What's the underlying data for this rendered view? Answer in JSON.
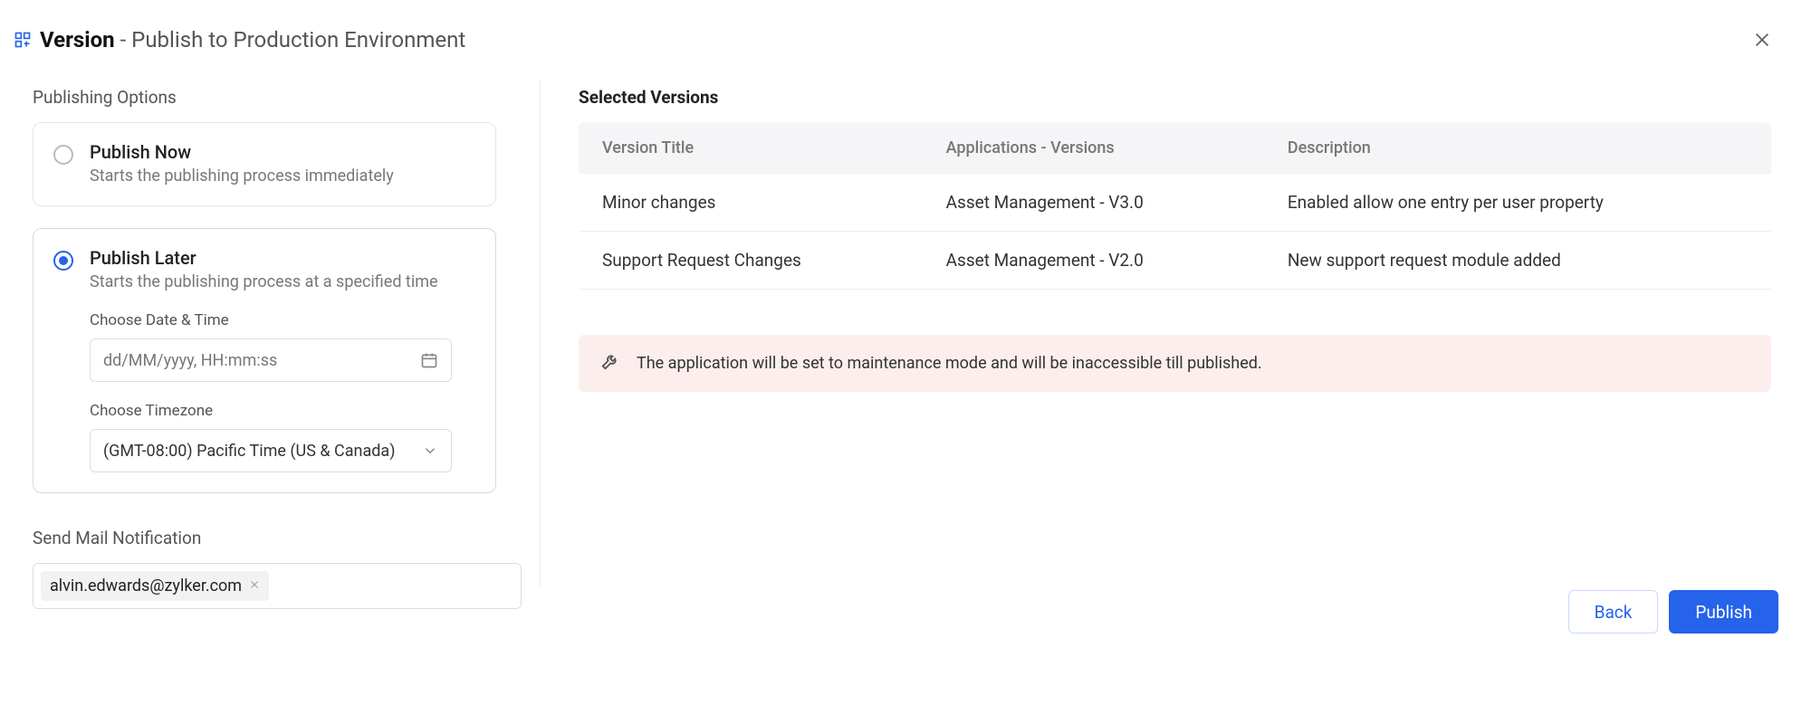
{
  "header": {
    "title_bold": "Version",
    "title_sub": "- Publish to Production Environment"
  },
  "left": {
    "publishing_options_label": "Publishing Options",
    "option_now": {
      "title": "Publish Now",
      "desc": "Starts the publishing process immediately"
    },
    "option_later": {
      "title": "Publish Later",
      "desc": "Starts the publishing process at a specified time",
      "date_label": "Choose Date & Time",
      "date_placeholder": "dd/MM/yyyy, HH:mm:ss",
      "tz_label": "Choose Timezone",
      "tz_value": "(GMT-08:00) Pacific Time (US & Canada)"
    },
    "mail_label": "Send Mail Notification",
    "mail_recipients": [
      "alvin.edwards@zylker.com"
    ]
  },
  "right": {
    "selected_versions_label": "Selected Versions",
    "columns": {
      "c1": "Version Title",
      "c2": "Applications - Versions",
      "c3": "Description"
    },
    "rows": [
      {
        "title": "Minor changes",
        "app": "Asset Management - V3.0",
        "desc": "Enabled allow one entry per user property"
      },
      {
        "title": "Support Request Changes",
        "app": "Asset Management - V2.0",
        "desc": "New support request module added"
      }
    ],
    "warning": "The application will be set to maintenance mode and will be inaccessible till published."
  },
  "footer": {
    "back": "Back",
    "publish": "Publish"
  }
}
